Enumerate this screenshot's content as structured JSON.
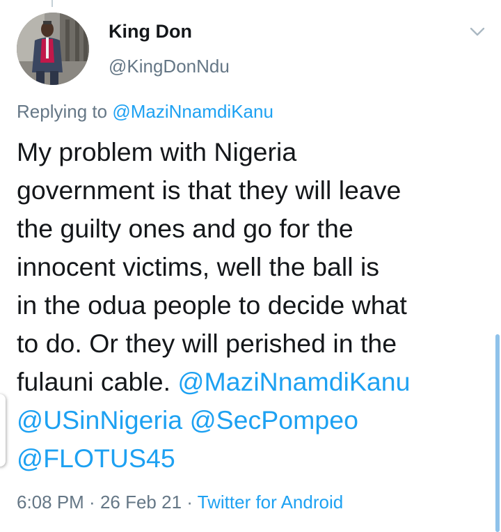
{
  "colors": {
    "link": "#1da1f2",
    "secondary_text": "#657786",
    "primary_text": "#14171a"
  },
  "author": {
    "display_name": "King Don",
    "handle": "@KingDonNdu",
    "avatar_icon": "profile-photo"
  },
  "menu": {
    "icon": "chevron-down-icon"
  },
  "reply_context": {
    "prefix": "Replying to ",
    "mention": "@MaziNnamdiKanu"
  },
  "tweet": {
    "lines": [
      "My problem with Nigeria",
      "government is that they will leave",
      "the guilty ones and go for the",
      "innocent victims, well the ball is",
      "in the odua people to decide what",
      "to do. Or they will perished in the",
      "fulauni cable."
    ],
    "mentions": [
      "@MaziNnamdiKanu",
      "@USinNigeria",
      "@SecPompeo",
      "@FLOTUS45"
    ]
  },
  "meta": {
    "time": "6:08 PM",
    "separator": " · ",
    "date": "26 Feb 21",
    "client": "Twitter for Android"
  }
}
